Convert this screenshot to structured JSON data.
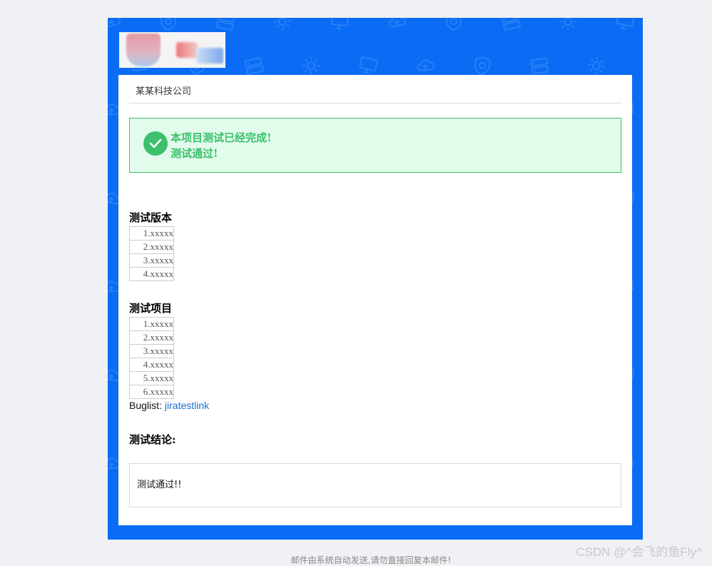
{
  "header": {
    "company": "某某科技公司"
  },
  "alert": {
    "line1": "本项目测试已经完成!",
    "line2": "测试通过!"
  },
  "versions": {
    "title": "测试版本",
    "items": [
      "1.xxxxx",
      "2.xxxxx",
      "3.xxxxx",
      "4.xxxxx"
    ]
  },
  "projects": {
    "title": "测试项目",
    "items": [
      "1.xxxxx",
      "2.xxxxx",
      "3.xxxxx",
      "4.xxxxx",
      "5.xxxxx",
      "6.xxxxx"
    ]
  },
  "buglist": {
    "label": "Buglist:",
    "link_text": "jiratestlink"
  },
  "conclusion": {
    "title": "测试结论:",
    "text": "测试通过!!"
  },
  "footer": {
    "note": "邮件由系统自动发送,请勿直接回复本邮件!"
  },
  "watermark": "CSDN @^会飞的鱼Fly^",
  "colors": {
    "frame_blue": "#0a6cf5",
    "success_green": "#3bbf6a",
    "success_bg": "#e2fcec",
    "link_blue": "#1a6fd3"
  },
  "icons": {
    "alert": "check-circle-icon",
    "background": [
      "cloud-icon",
      "shield-icon",
      "server-icon",
      "gear-icon",
      "monitor-icon"
    ]
  }
}
